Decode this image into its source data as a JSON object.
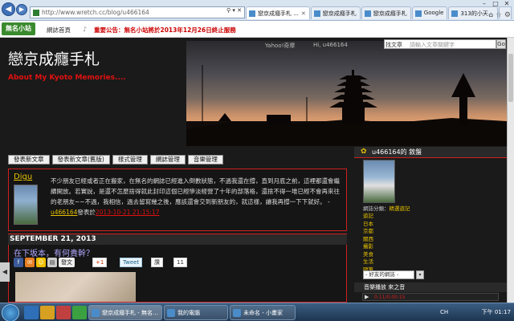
{
  "browser": {
    "url": "http://www.wretch.cc/blog/u466164",
    "tabs": [
      {
        "label": "戀京成癮手札 ..."
      },
      {
        "label": "戀京成癮手札"
      },
      {
        "label": "戀京成癮手札"
      },
      {
        "label": "Google"
      },
      {
        "label": "313的小天..."
      }
    ]
  },
  "site": {
    "logo": "無名小站",
    "home": "網誌首頁",
    "notice": "重要公告：無名小站將於2013年12月26日終止服務"
  },
  "blog": {
    "title": "戀京成癮手札",
    "subtitle": "About My Kyoto Memories....",
    "links": "Yahoo!奇摩",
    "user_hi": "Hi, u466164",
    "search_select": "找文章",
    "search_placeholder": "請輸入文章關鍵字",
    "search_btn": "Go"
  },
  "menu": [
    {
      "label": "發表新文章"
    },
    {
      "label": "發表新文章(舊版)"
    },
    {
      "label": "樣式管理"
    },
    {
      "label": "網誌管理"
    },
    {
      "label": "音樂管理"
    }
  ],
  "message": {
    "user": "Digu",
    "text": "不少朋友已經或者正在搬家，在無名的網誌已經進入倒數狀態，不過我還在撐，直到月底之前，這裡都還會繼續開放。若實說，是還不怎麼捨得就此封印這個已經慘淡經營了十年的部落格，還捨不得一堆已經不會再來往的老朋友~~不過，我相信，過去留寫幾之後，應該還會交到新朋友的，就這樣，讓我再撐一下下就好。 -",
    "author": "u466164",
    "posted_word": "發表於",
    "time": "2013-10-21 21:15:17"
  },
  "post": {
    "date": "SEPTEMBER 21, 2013",
    "title": "在下坂本，有何貴幹？",
    "share_label": "發文",
    "gplus": "+1",
    "tweet": "Tweet",
    "plurk": "讚",
    "count": "11"
  },
  "sidebar": {
    "header": "u466164的 敘盤",
    "info_label": "網誌分類：",
    "info_value": "精選遊記",
    "items": [
      "遊記",
      "日本",
      "京都",
      "關西",
      "攝影",
      "美食",
      "生活",
      "隨筆",
      "其他",
      "留言板",
      "好友"
    ],
    "select": "- 好友的網誌 -",
    "music_header": "音樂播放 來之音",
    "player_time": "0:11/0:00:15"
  },
  "taskbar": {
    "items": [
      {
        "label": "戀京成癮手札 - 無名..."
      },
      {
        "label": "我的電腦"
      },
      {
        "label": "未命名 - 小畫家"
      }
    ],
    "lang": "CH",
    "clock": "下午 01:17"
  },
  "colors": {
    "accent_red": "#d02020",
    "link_yellow": "#e6c000",
    "title_purple": "#b0a8ff"
  }
}
